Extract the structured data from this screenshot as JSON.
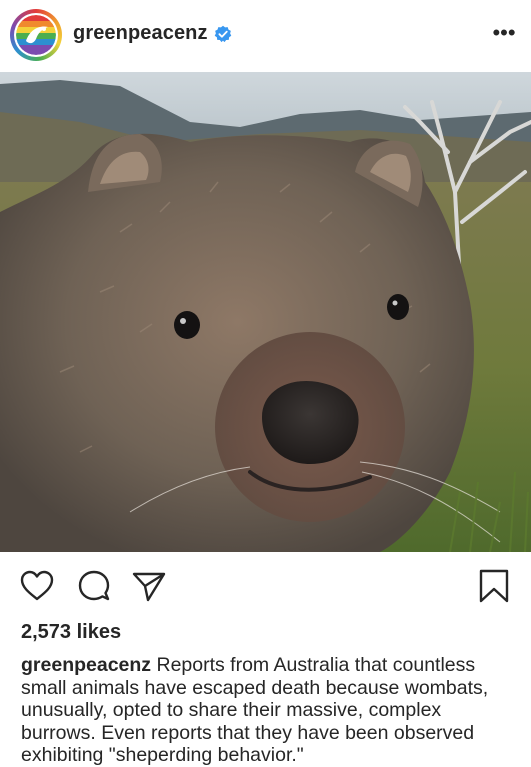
{
  "post": {
    "username": "greenpeacenz",
    "verified_icon": "verified-badge-icon",
    "more_icon": "more-options-icon",
    "more_label": "•••",
    "image_description_icon": "photo",
    "likes": "2,573 likes",
    "caption_user": "greenpeacenz",
    "caption_text": "Reports from Australia that countless small animals have escaped death because wombats, unusually, opted to share their massive, complex burrows. Even reports that they have been observed exhibiting \"sheperding behavior.\""
  },
  "actions": {
    "like_icon": "heart-icon",
    "comment_icon": "comment-icon",
    "share_icon": "send-icon",
    "save_icon": "bookmark-icon"
  },
  "colors": {
    "text": "#262626",
    "verified_blue": "#3897f0",
    "background": "#ffffff"
  }
}
